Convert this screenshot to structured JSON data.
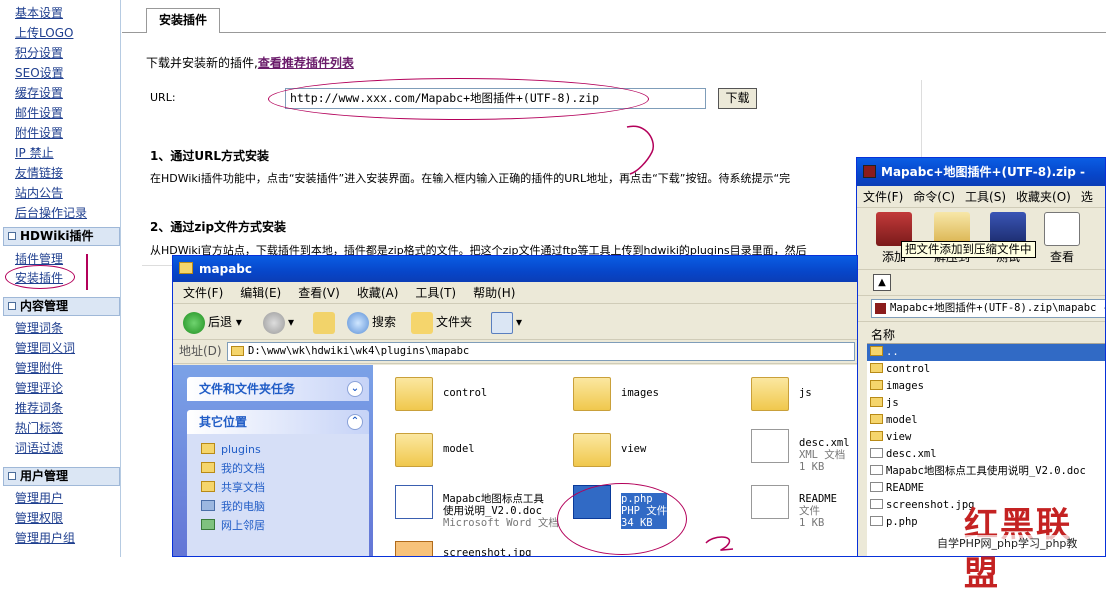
{
  "sidebar": {
    "top_items": [
      "基本设置",
      "上传LOGO",
      "积分设置",
      "SEO设置",
      "缓存设置",
      "邮件设置",
      "附件设置",
      "IP 禁止",
      "友情链接",
      "站内公告",
      "后台操作记录"
    ],
    "sections": [
      {
        "title": "HDWiki插件",
        "items": [
          "插件管理",
          "安装插件"
        ]
      },
      {
        "title": "内容管理",
        "items": [
          "管理词条",
          "管理同义词",
          "管理附件",
          "管理评论",
          "推荐词条",
          "热门标签",
          "词语过滤"
        ]
      },
      {
        "title": "用户管理",
        "items": [
          "管理用户",
          "管理权限",
          "管理用户组"
        ]
      }
    ]
  },
  "main": {
    "tab_label": "安装插件",
    "intro_text": "下载并安装新的插件,",
    "intro_link": "查看推荐插件列表",
    "url_label": "URL:",
    "url_value": "http://www.xxx.com/Mapabc+地图插件+(UTF-8).zip",
    "download_button": "下载",
    "section1_title": "1、通过URL方式安装",
    "section1_body": "在HDWiki插件功能中，点击“安装插件”进入安装界面。在输入框内输入正确的插件的URL地址，再点击“下载”按钮。待系统提示“完",
    "section2_title": "2、通过zip文件方式安装",
    "section2_body": "从HDWiki官方站点，下载插件到本地，插件都是zip格式的文件。把这个zip文件通过ftp等工具上传到hdwiki的plugins目录里面，然后"
  },
  "explorer": {
    "title": "mapabc",
    "menu": [
      "文件(F)",
      "编辑(E)",
      "查看(V)",
      "收藏(A)",
      "工具(T)",
      "帮助(H)"
    ],
    "toolbar": {
      "back": "后退",
      "search": "搜索",
      "folders": "文件夹"
    },
    "address_label": "地址(D)",
    "address_value": "D:\\www\\wk\\hdwiki\\wk4\\plugins\\mapabc",
    "tasks_title": "文件和文件夹任务",
    "places_title": "其它位置",
    "places": [
      "plugins",
      "我的文档",
      "共享文档",
      "我的电脑",
      "网上邻居"
    ],
    "files": [
      {
        "name": "control",
        "meta": ""
      },
      {
        "name": "images",
        "meta": ""
      },
      {
        "name": "js",
        "meta": ""
      },
      {
        "name": "model",
        "meta": ""
      },
      {
        "name": "view",
        "meta": ""
      },
      {
        "name": "desc.xml",
        "meta": "XML 文档",
        "size": "1 KB"
      },
      {
        "name": "Mapabc地图标点工具",
        "name2": "使用说明_V2.0.doc",
        "meta": "Microsoft Word 文档"
      },
      {
        "name": "p.php",
        "meta": "PHP 文件",
        "size": "34 KB"
      },
      {
        "name": "README",
        "meta": "文件",
        "size": "1 KB"
      },
      {
        "name": "screenshot.jpg",
        "meta": ""
      }
    ]
  },
  "winrar": {
    "title": "Mapabc+地图插件+(UTF-8).zip -",
    "menu": [
      "文件(F)",
      "命令(C)",
      "工具(S)",
      "收藏夹(O)",
      "选"
    ],
    "buttons": [
      "添加",
      "解压到",
      "测试",
      "查看"
    ],
    "tooltip": "把文件添加到压缩文件中",
    "path": "Mapabc+地图插件+(UTF-8).zip\\mapabc -",
    "column_header": "名称",
    "rows": [
      "..",
      "control",
      "images",
      "js",
      "model",
      "view",
      "desc.xml",
      "Mapabc地图标点工具使用说明_V2.0.doc",
      "README",
      "screenshot.jpg",
      "p.php"
    ]
  },
  "watermark": {
    "big": "红黑联盟",
    "small": "自学PHP网_php学习_php教"
  },
  "colors": {
    "link": "#1f3f8f",
    "annotation": "#b3005a",
    "titlebar": "#0746c9",
    "watermark": "#c42222"
  }
}
